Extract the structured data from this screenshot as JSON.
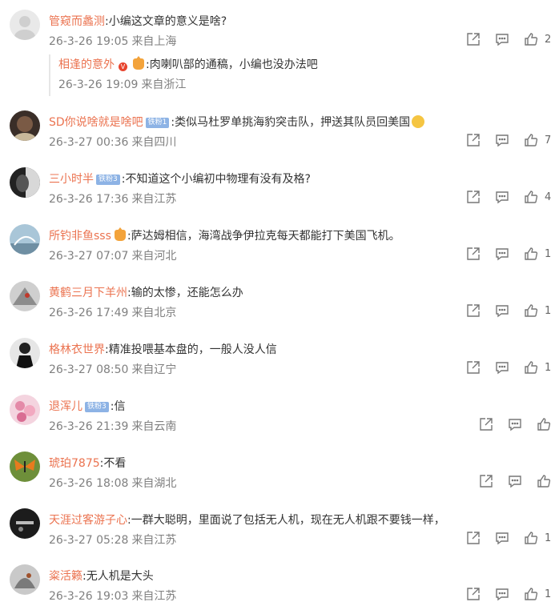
{
  "comments": [
    {
      "username": "管窥而蠡测",
      "text": ":小编这文章的意义是啥?",
      "date": "26-3-26 19:05",
      "location": "来自上海",
      "likes": "2",
      "reply": {
        "username": "相逢的意外",
        "text": ":肉喇叭部的通稿，小编也没办法吧",
        "date": "26-3-26 19:09",
        "location": "来自浙江"
      }
    },
    {
      "username": "SD你说啥就是啥吧",
      "badge": "铁粉1",
      "text": ":类似马杜罗单挑海豹突击队，押送其队员回美国",
      "date": "26-3-27 00:36",
      "location": "来自四川",
      "likes": "7"
    },
    {
      "username": "三小时半",
      "badge": "铁粉3",
      "text": ":不知道这个小编初中物理有没有及格?",
      "date": "26-3-26 17:36",
      "location": "来自江苏",
      "likes": "4"
    },
    {
      "username": "所钓非鱼sss",
      "text": ":萨达姆相信，海湾战争伊拉克每天都能打下美国飞机。",
      "date": "26-3-27 07:07",
      "location": "来自河北",
      "likes": "1"
    },
    {
      "username": "黄鹤三月下羊州",
      "text": ":输的太惨，还能怎么办",
      "date": "26-3-26 17:49",
      "location": "来自北京",
      "likes": "1"
    },
    {
      "username": "格林衣世界",
      "text": ":精准投喂基本盘的，一般人没人信",
      "date": "26-3-27 08:50",
      "location": "来自辽宁",
      "likes": "1"
    },
    {
      "username": "退浑儿",
      "badge": "铁粉3",
      "text": ":信",
      "date": "26-3-26 21:39",
      "location": "来自云南",
      "likes": ""
    },
    {
      "username": "琥珀7875",
      "text": ":不看",
      "date": "26-3-26 18:08",
      "location": "来自湖北",
      "likes": ""
    },
    {
      "username": "天涯过客游子心",
      "text": ":一群大聪明，里面说了包括无人机，现在无人机跟不要钱一样，",
      "date": "26-3-27 05:28",
      "location": "来自江苏",
      "likes": "1"
    },
    {
      "username": "粢活籁",
      "text": ":无人机是大头",
      "date": "26-3-26 19:03",
      "location": "来自江苏",
      "likes": "1"
    }
  ],
  "colors": {
    "username": "#eb7350",
    "meta": "#808080",
    "icon": "#777777"
  },
  "icons": [
    "share-icon",
    "comment-icon",
    "like-icon"
  ]
}
